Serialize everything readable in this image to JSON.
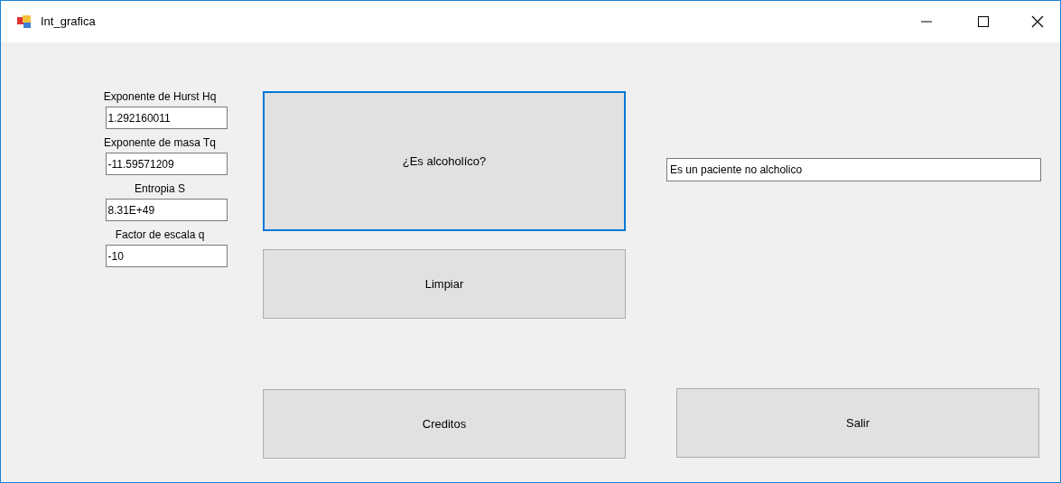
{
  "window": {
    "title": "Int_grafica"
  },
  "fields": [
    {
      "label": "Exponente de Hurst Hq",
      "value": "1.292160011"
    },
    {
      "label": "Exponente de masa Tq",
      "value": "-11.59571209"
    },
    {
      "label": "Entropia S",
      "value": "8.31E+49"
    },
    {
      "label": "Factor de escala q",
      "value": "-10"
    }
  ],
  "buttons": [
    {
      "label": "¿Es alcoholíco?",
      "focused": true
    },
    {
      "label": "Limpiar",
      "focused": false
    },
    {
      "label": "Creditos",
      "focused": false
    },
    {
      "label": "Salir",
      "focused": false
    }
  ],
  "result": {
    "value": "Es un paciente no alcholico"
  }
}
